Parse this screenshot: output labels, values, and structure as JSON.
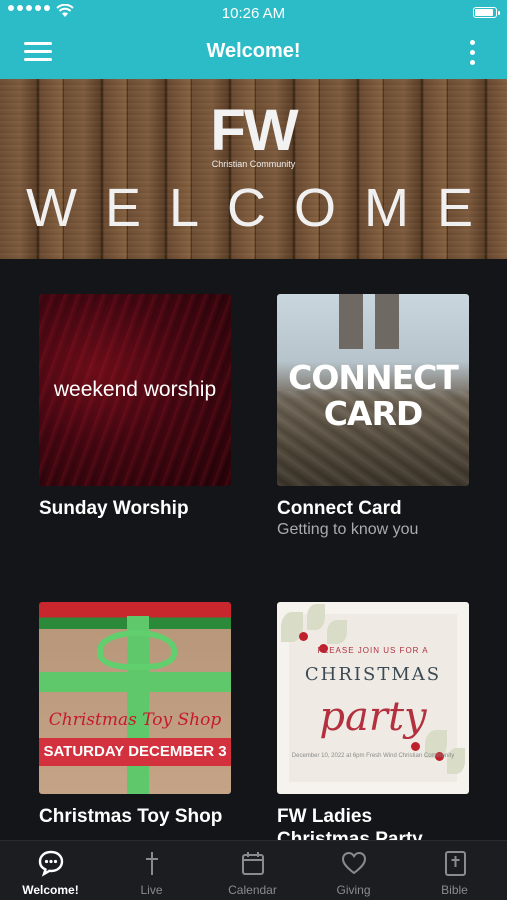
{
  "status_bar": {
    "time": "10:26 AM"
  },
  "navbar": {
    "title": "Welcome!"
  },
  "hero": {
    "logo": "FW",
    "subtitle": "Christian Community",
    "welcome": "WELCOME"
  },
  "cards": [
    {
      "title": "Sunday Worship",
      "subtitle": "",
      "image_text": "weekend worship"
    },
    {
      "title": "Connect Card",
      "subtitle": "Getting to know you",
      "image_text_line1": "CONNECT",
      "image_text_line2": "CARD"
    },
    {
      "title": "Christmas Toy Shop",
      "subtitle": "",
      "image_script": "Christmas Toy Shop",
      "image_date": "SATURDAY DECEMBER 3"
    },
    {
      "title": "FW Ladies Christmas Party",
      "subtitle": "",
      "image_small": "PLEASE JOIN US FOR A",
      "image_big": "CHRISTMAS",
      "image_script": "party",
      "image_fine": "December 10, 2022 at 6pm Fresh Wind Christian Community"
    }
  ],
  "tabs": [
    {
      "label": "Welcome!",
      "icon": "chat-bubble-icon",
      "active": true
    },
    {
      "label": "Live",
      "icon": "cross-icon",
      "active": false
    },
    {
      "label": "Calendar",
      "icon": "calendar-icon",
      "active": false
    },
    {
      "label": "Giving",
      "icon": "heart-icon",
      "active": false
    },
    {
      "label": "Bible",
      "icon": "bible-icon",
      "active": false
    }
  ],
  "colors": {
    "accent": "#2cbcc7",
    "background": "#141518",
    "tabbar": "#1c1d21"
  }
}
